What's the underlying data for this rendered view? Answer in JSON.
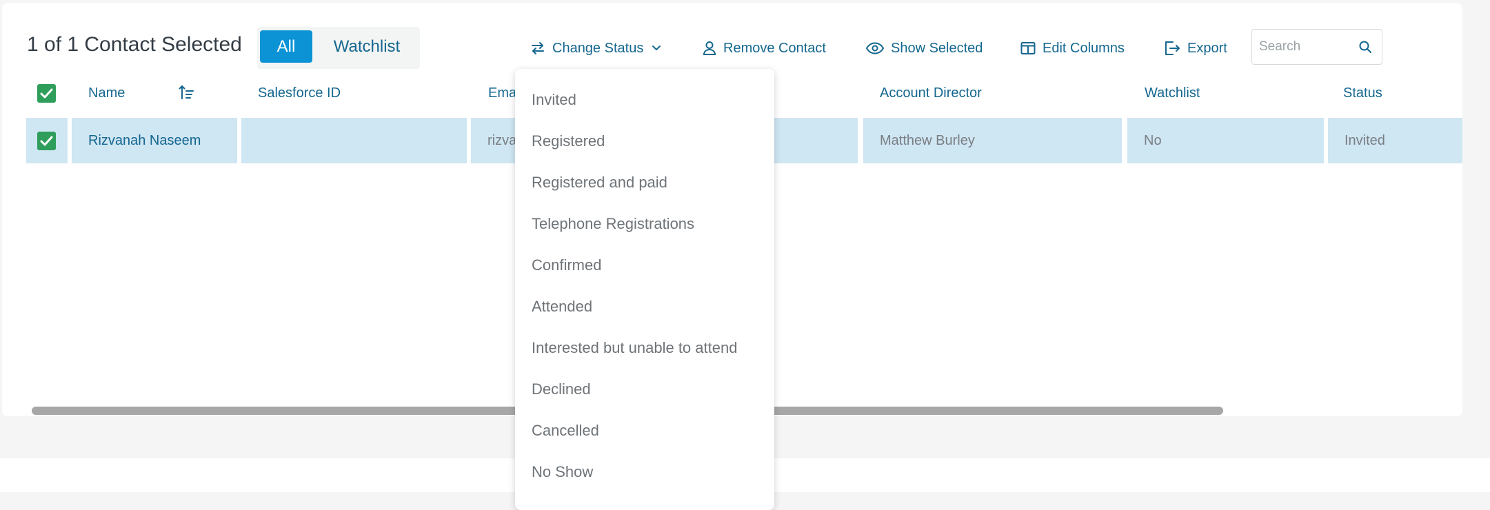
{
  "header": {
    "selection_text": "1 of 1 Contact Selected",
    "segment": {
      "all_label": "All",
      "watchlist_label": "Watchlist",
      "active": "All"
    }
  },
  "toolbar": {
    "change_status_label": "Change Status",
    "remove_contact_label": "Remove Contact",
    "show_selected_label": "Show Selected",
    "edit_columns_label": "Edit Columns",
    "export_label": "Export",
    "search_placeholder": "Search",
    "search_value": ""
  },
  "table": {
    "columns": [
      "Name",
      "Salesforce ID",
      "Ema",
      "Account Director",
      "Watchlist",
      "Status"
    ],
    "rows": [
      {
        "selected": true,
        "name": "Rizvanah Naseem",
        "salesforce_id": "",
        "email": "rizva",
        "col4": "",
        "account_director": "Matthew Burley",
        "watchlist": "No",
        "status": "Invited"
      }
    ]
  },
  "status_dropdown": {
    "options": [
      "Invited",
      "Registered",
      "Registered and paid",
      "Telephone Registrations",
      "Confirmed",
      "Attended",
      "Interested but unable to attend",
      "Declined",
      "Cancelled",
      "No Show"
    ]
  },
  "icons": {
    "checkbox": "checkbox-checked-icon",
    "sort": "sort-ascending-icon",
    "change_status": "swap-arrows-icon",
    "chevron": "chevron-down-icon",
    "remove": "user-icon",
    "show": "eye-icon",
    "columns": "columns-icon",
    "export": "export-icon",
    "search": "search-icon"
  },
  "colors": {
    "accent": "#0b93d6",
    "link": "#14678f",
    "checkbox": "#2f9e5b",
    "row_selected_bg": "#cfe6f3",
    "page_bg": "#f4f5f4"
  }
}
